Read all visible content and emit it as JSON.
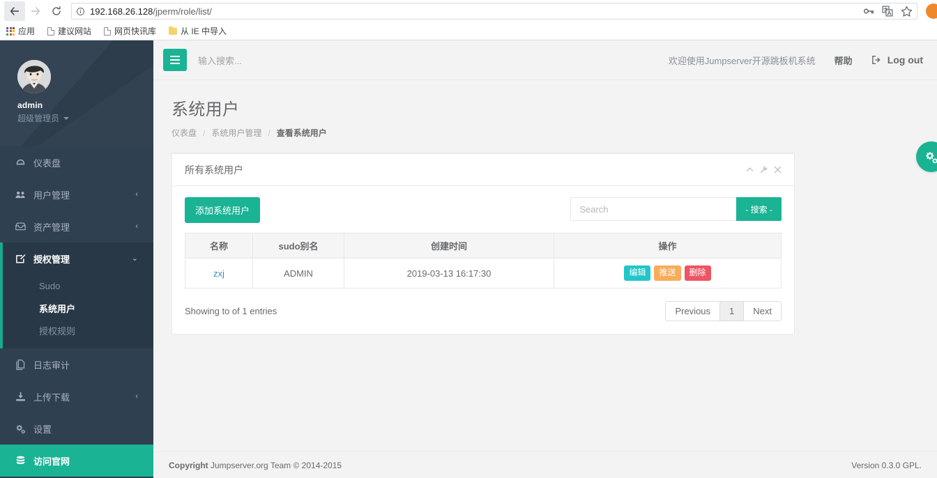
{
  "browser": {
    "back_icon": "arrow-left-icon",
    "forward_icon": "arrow-right-icon",
    "reload_icon": "reload-icon",
    "url_host": "192.168.26.128",
    "url_path": "/jperm/role/list/",
    "info_icon": "info-circle-icon",
    "omni_icons": [
      "key-icon",
      "translate-icon",
      "star-icon"
    ],
    "bookmarks": [
      {
        "label": "应用",
        "icon": "apps-grid-icon"
      },
      {
        "label": "建议网站",
        "icon": "document-icon"
      },
      {
        "label": "网页快讯库",
        "icon": "document-icon"
      },
      {
        "label": "从 IE 中导入",
        "icon": "folder-icon"
      }
    ]
  },
  "sidebar": {
    "profile": {
      "name": "admin",
      "role": "超级管理员",
      "avatar_icon": "user-avatar",
      "caret_icon": "caret-down-icon"
    },
    "items": [
      {
        "label": "仪表盘",
        "icon": "dashboard-icon",
        "chevron": ""
      },
      {
        "label": "用户管理",
        "icon": "users-icon",
        "chevron": "‹"
      },
      {
        "label": "资产管理",
        "icon": "inbox-icon",
        "chevron": "‹"
      },
      {
        "label": "授权管理",
        "icon": "edit-square-icon",
        "chevron": "⌄"
      },
      {
        "label": "日志审计",
        "icon": "files-icon",
        "chevron": ""
      },
      {
        "label": "上传下载",
        "icon": "download-icon",
        "chevron": "‹"
      },
      {
        "label": "设置",
        "icon": "gears-icon",
        "chevron": ""
      },
      {
        "label": "访问官网",
        "icon": "database-icon",
        "chevron": ""
      }
    ],
    "subitems": [
      {
        "label": "Sudo"
      },
      {
        "label": "系统用户"
      },
      {
        "label": "授权规则"
      }
    ]
  },
  "topbar": {
    "burger_icon": "hamburger-icon",
    "search_placeholder": "输入搜索...",
    "welcome": "欢迎使用Jumpserver开源跳板机系统",
    "help": "帮助",
    "logout": "Log out",
    "logout_icon": "sign-out-icon"
  },
  "page": {
    "title": "系统用户",
    "breadcrumb": [
      {
        "label": "仪表盘",
        "current": false
      },
      {
        "label": "系统用户管理",
        "current": false
      },
      {
        "label": "查看系统用户",
        "current": true
      }
    ],
    "fab_icon": "gears-icon"
  },
  "panel": {
    "title": "所有系统用户",
    "tools": [
      "chevron-up-icon",
      "wrench-icon",
      "close-icon"
    ],
    "add_button": "添加系统用户",
    "search_placeholder": "Search",
    "search_value": "",
    "search_button": "- 搜索 -",
    "table": {
      "headers": [
        "名称",
        "sudo别名",
        "创建时间",
        "操作"
      ],
      "rows": [
        {
          "name": "zxj",
          "sudo_alias": "ADMIN",
          "created": "2019-03-13 16:17:30",
          "actions": [
            "编辑",
            "推送",
            "删除"
          ]
        }
      ]
    },
    "entries_text": "Showing to of 1 entries",
    "pagination": {
      "previous": "Previous",
      "page": "1",
      "next": "Next"
    }
  },
  "footer": {
    "copyright_strong": "Copyright",
    "copyright_rest": " Jumpserver.org Team © 2014-2015",
    "version": "Version 0.3.0 GPL."
  },
  "colors": {
    "brand_green": "#1ab394",
    "sidebar_dark": "#2f4050",
    "sidebar_darker": "#293846",
    "link_blue": "#3c8dbc",
    "edit": "#23c6c8",
    "push": "#f8ac59",
    "delete": "#ed5565"
  }
}
